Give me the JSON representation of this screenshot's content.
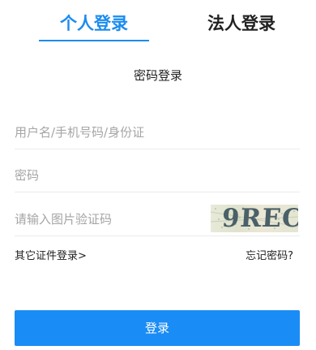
{
  "tabs": {
    "personal": "个人登录",
    "legal": "法人登录",
    "active_color": "#1a8cf0"
  },
  "subtitle": "密码登录",
  "fields": {
    "username_placeholder": "用户名/手机号码/身份证",
    "password_placeholder": "密码",
    "captcha_placeholder": "请输入图片验证码"
  },
  "captcha": {
    "text": "9REC"
  },
  "links": {
    "other_cert": "其它证件登录>",
    "forgot": "忘记密码?"
  },
  "login_button": {
    "label": "登录",
    "color": "#1a8cf5"
  }
}
